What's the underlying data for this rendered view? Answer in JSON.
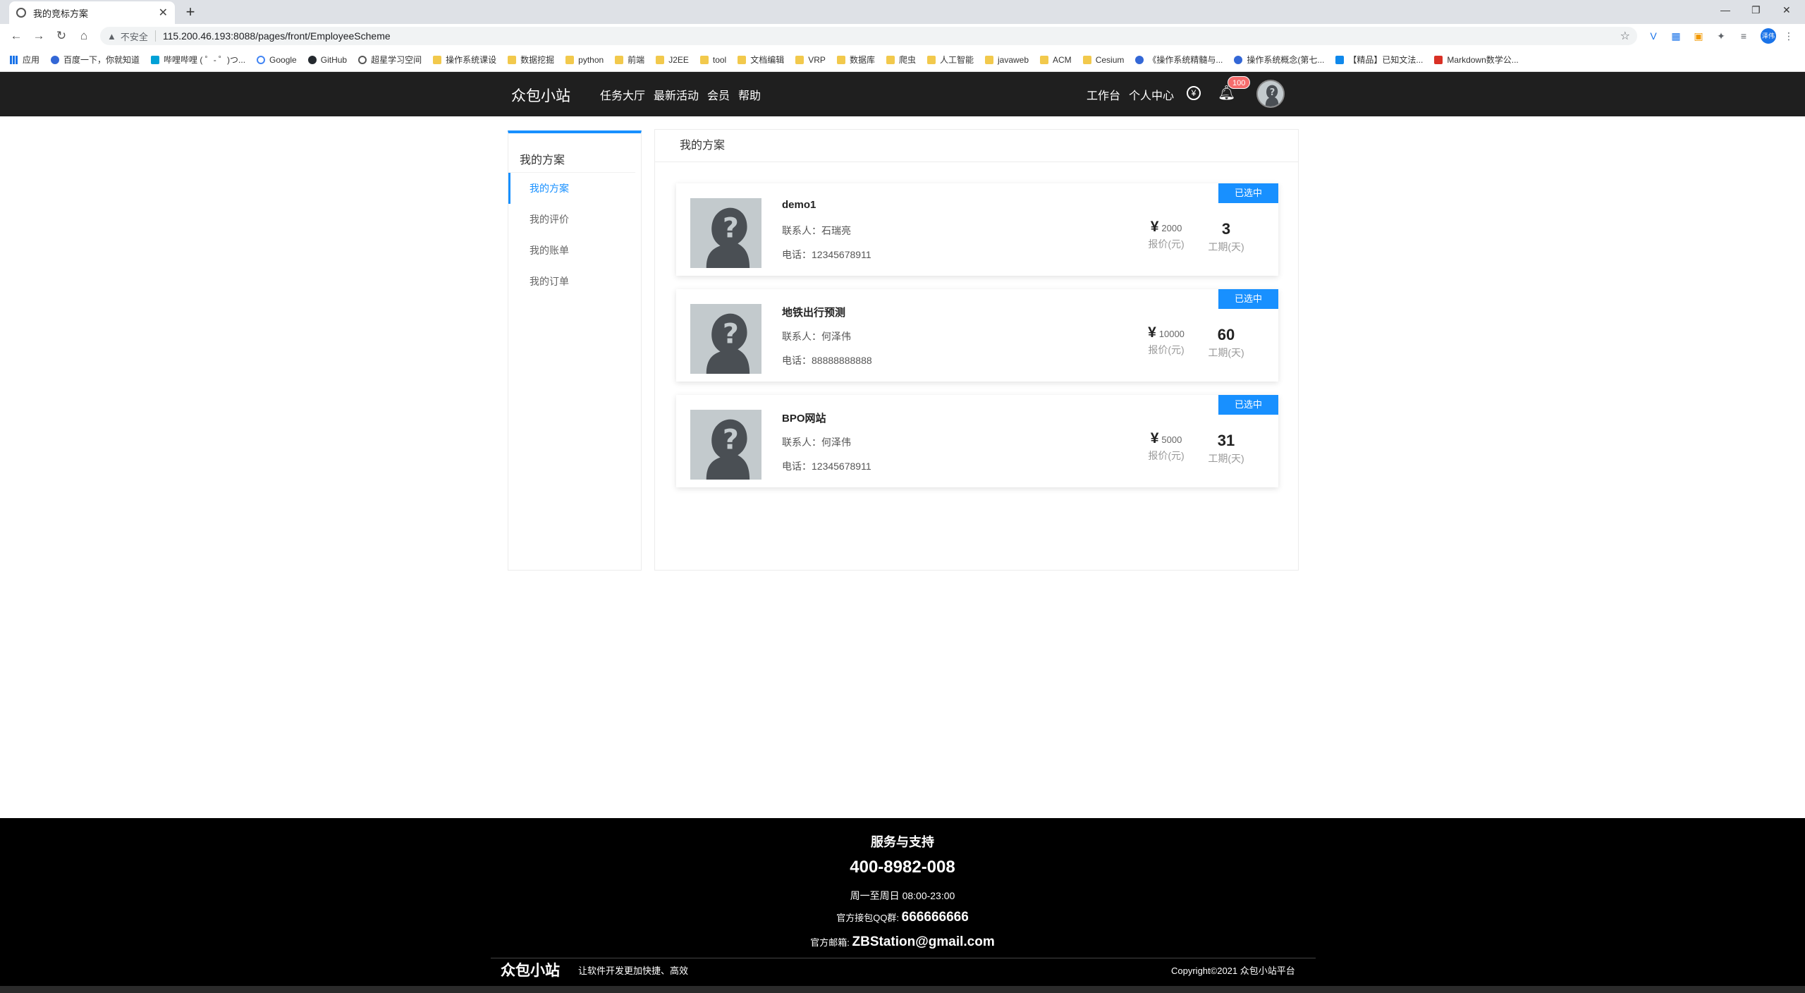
{
  "browser": {
    "tab_title": "我的竞标方案",
    "url": "115.200.46.193:8088/pages/front/EmployeeScheme",
    "insecure_label": "不安全",
    "profile_label": "泽伟",
    "bookmarks": [
      "应用",
      "百度一下，你就知道",
      "哔哩哔哩 ( ゜- ゜)つ...",
      "Google",
      "GitHub",
      "超星学习空间",
      "操作系统课设",
      "数据挖掘",
      "python",
      "前端",
      "J2EE",
      "tool",
      "文档编辑",
      "VRP",
      "数据库",
      "爬虫",
      "人工智能",
      "javaweb",
      "ACM",
      "Cesium",
      "《操作系统精髓与...",
      "操作系统概念(第七...",
      "【精品】已知文法...",
      "Markdown数学公..."
    ]
  },
  "header": {
    "logo": "众包小站",
    "nav": [
      "任务大厅",
      "最新活动",
      "会员",
      "帮助"
    ],
    "right_nav": [
      "工作台",
      "个人中心"
    ],
    "notification_count": "100"
  },
  "sidebar": {
    "title": "我的方案",
    "items": [
      {
        "label": "我的方案",
        "active": true
      },
      {
        "label": "我的评价",
        "active": false
      },
      {
        "label": "我的账单",
        "active": false
      },
      {
        "label": "我的订单",
        "active": false
      }
    ]
  },
  "main": {
    "title": "我的方案",
    "price_label": "报价(元)",
    "period_label": "工期(天)",
    "schemes": [
      {
        "name": "demo1",
        "contact": "联系人：石瑞亮",
        "phone": "电话：12345678911",
        "price": "2000",
        "days": "3",
        "status": "已选中"
      },
      {
        "name": "地铁出行预测",
        "contact": "联系人：何泽伟",
        "phone": "电话：88888888888",
        "price": "10000",
        "days": "60",
        "status": "已选中"
      },
      {
        "name": "BPO网站",
        "contact": "联系人：何泽伟",
        "phone": "电话：12345678911",
        "price": "5000",
        "days": "31",
        "status": "已选中"
      }
    ]
  },
  "footer": {
    "title": "服务与支持",
    "tel": "400-8982-008",
    "hours": "周一至周日 08:00-23:00",
    "qq_label": "官方接包QQ群:",
    "qq": "666666666",
    "mail_label": "官方邮箱:",
    "mail": "ZBStation@gmail.com",
    "logo": "众包小站",
    "slogan": "让软件开发更加快捷、高效",
    "copyright": "Copyright©2021 众包小站平台"
  },
  "colors": {
    "accent": "#1890ff",
    "header_bg": "#1f1f1f",
    "footer_bg": "#000000"
  }
}
